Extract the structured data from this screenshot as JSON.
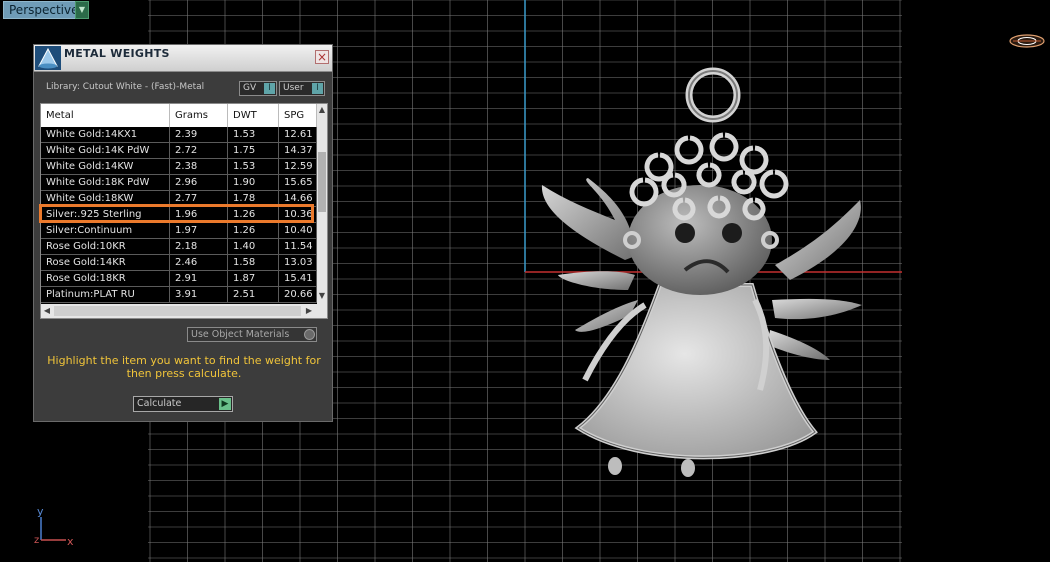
{
  "viewport": {
    "label": "Perspective",
    "label_arrow": "▼",
    "axes": {
      "y": "y",
      "x": "x",
      "z": "z"
    }
  },
  "panel": {
    "title": "METAL WEIGHTS",
    "close_label": "×",
    "library": "Library: Cutout White - (Fast)-Metal",
    "toggles": [
      {
        "label": "GV",
        "knob": "I"
      },
      {
        "label": "User",
        "knob": "I"
      }
    ],
    "columns": [
      "Metal",
      "Grams",
      "DWT",
      "SPG"
    ],
    "rows": [
      {
        "metal": "White Gold:14KX1",
        "grams": "2.39",
        "dwt": "1.53",
        "spg": "12.61"
      },
      {
        "metal": "White Gold:14K PdW",
        "grams": "2.72",
        "dwt": "1.75",
        "spg": "14.37"
      },
      {
        "metal": "White Gold:14KW",
        "grams": "2.38",
        "dwt": "1.53",
        "spg": "12.59"
      },
      {
        "metal": "White Gold:18K PdW",
        "grams": "2.96",
        "dwt": "1.90",
        "spg": "15.65"
      },
      {
        "metal": "White Gold:18KW",
        "grams": "2.77",
        "dwt": "1.78",
        "spg": "14.66"
      },
      {
        "metal": "Silver:.925 Sterling",
        "grams": "1.96",
        "dwt": "1.26",
        "spg": "10.36"
      },
      {
        "metal": "Silver:Continuum",
        "grams": "1.97",
        "dwt": "1.26",
        "spg": "10.40"
      },
      {
        "metal": "Rose Gold:10KR",
        "grams": "2.18",
        "dwt": "1.40",
        "spg": "11.54"
      },
      {
        "metal": "Rose Gold:14KR",
        "grams": "2.46",
        "dwt": "1.58",
        "spg": "13.03"
      },
      {
        "metal": "Rose Gold:18KR",
        "grams": "2.91",
        "dwt": "1.87",
        "spg": "15.41"
      },
      {
        "metal": "Platinum:PLAT RU",
        "grams": "3.91",
        "dwt": "2.51",
        "spg": "20.66"
      }
    ],
    "selected_row": "Silver:.925 Sterling",
    "use_object_materials": "Use Object Materials",
    "instructions": "Highlight the item you want to find the weight for then press calculate.",
    "calculate_label": "Calculate"
  },
  "colors": {
    "highlight": "#ec7a2c",
    "instruction_text": "#f0c43a",
    "grid": "#7a7a7a",
    "axis_blue": "#3a9ccc",
    "axis_red": "#c43030"
  }
}
